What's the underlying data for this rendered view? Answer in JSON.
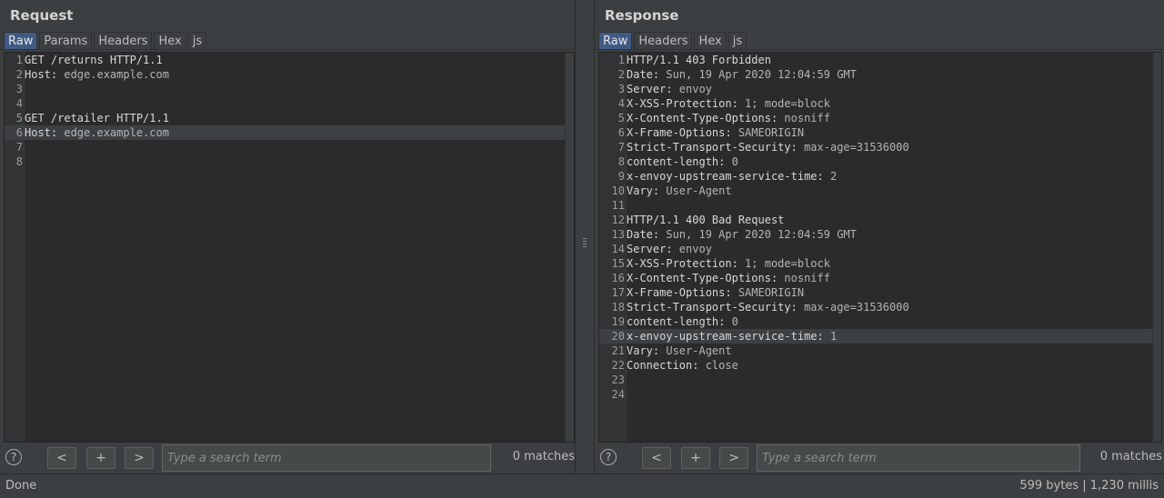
{
  "request": {
    "title": "Request",
    "tabs": [
      {
        "label": "Raw",
        "active": true
      },
      {
        "label": "Params",
        "active": false
      },
      {
        "label": "Headers",
        "active": false
      },
      {
        "label": "Hex",
        "active": false
      },
      {
        "label": "js",
        "active": false
      }
    ],
    "lines": [
      {
        "n": "1",
        "key": "GET /returns HTTP/1.1",
        "val": ""
      },
      {
        "n": "2",
        "key": "Host:",
        "val": " edge.example.com"
      },
      {
        "n": "3",
        "key": "",
        "val": ""
      },
      {
        "n": "4",
        "key": "",
        "val": ""
      },
      {
        "n": "5",
        "key": "GET /retailer HTTP/1.1",
        "val": ""
      },
      {
        "n": "6",
        "key": "Host:",
        "val": " edge.example.com",
        "selected": true
      },
      {
        "n": "7",
        "key": "",
        "val": ""
      },
      {
        "n": "8",
        "key": "",
        "val": ""
      }
    ],
    "search": {
      "help": "?",
      "prev": "<",
      "add": "+",
      "next": ">",
      "placeholder": "Type a search term",
      "matches": "0 matches"
    }
  },
  "response": {
    "title": "Response",
    "tabs": [
      {
        "label": "Raw",
        "active": true
      },
      {
        "label": "Headers",
        "active": false
      },
      {
        "label": "Hex",
        "active": false
      },
      {
        "label": "js",
        "active": false
      }
    ],
    "lines": [
      {
        "n": "1",
        "key": "HTTP/1.1 403 Forbidden",
        "val": ""
      },
      {
        "n": "2",
        "key": "Date:",
        "val": " Sun, 19 Apr 2020 12:04:59 GMT"
      },
      {
        "n": "3",
        "key": "Server:",
        "val": " envoy"
      },
      {
        "n": "4",
        "key": "X-XSS-Protection:",
        "val": " 1; mode=block"
      },
      {
        "n": "5",
        "key": "X-Content-Type-Options:",
        "val": " nosniff"
      },
      {
        "n": "6",
        "key": "X-Frame-Options:",
        "val": " SAMEORIGIN"
      },
      {
        "n": "7",
        "key": "Strict-Transport-Security:",
        "val": " max-age=31536000"
      },
      {
        "n": "8",
        "key": "content-length:",
        "val": " 0"
      },
      {
        "n": "9",
        "key": "x-envoy-upstream-service-time:",
        "val": " 2"
      },
      {
        "n": "10",
        "key": "Vary:",
        "val": " User-Agent"
      },
      {
        "n": "11",
        "key": "",
        "val": ""
      },
      {
        "n": "12",
        "key": "HTTP/1.1 400 Bad Request",
        "val": ""
      },
      {
        "n": "13",
        "key": "Date:",
        "val": " Sun, 19 Apr 2020 12:04:59 GMT"
      },
      {
        "n": "14",
        "key": "Server:",
        "val": " envoy"
      },
      {
        "n": "15",
        "key": "X-XSS-Protection:",
        "val": " 1; mode=block"
      },
      {
        "n": "16",
        "key": "X-Content-Type-Options:",
        "val": " nosniff"
      },
      {
        "n": "17",
        "key": "X-Frame-Options:",
        "val": " SAMEORIGIN"
      },
      {
        "n": "18",
        "key": "Strict-Transport-Security:",
        "val": " max-age=31536000"
      },
      {
        "n": "19",
        "key": "content-length:",
        "val": " 0"
      },
      {
        "n": "20",
        "key": "x-envoy-upstream-service-time:",
        "val": " 1",
        "selected": true
      },
      {
        "n": "21",
        "key": "Vary:",
        "val": " User-Agent"
      },
      {
        "n": "22",
        "key": "Connection:",
        "val": " close"
      },
      {
        "n": "23",
        "key": "",
        "val": ""
      },
      {
        "n": "24",
        "key": "",
        "val": ""
      }
    ],
    "search": {
      "help": "?",
      "prev": "<",
      "add": "+",
      "next": ">",
      "placeholder": "Type a search term",
      "matches": "0 matches"
    }
  },
  "status": {
    "left": "Done",
    "right": "599 bytes | 1,230 millis"
  },
  "icons": {
    "help": "help-circle-icon",
    "divider": "drag-grip-icon"
  }
}
